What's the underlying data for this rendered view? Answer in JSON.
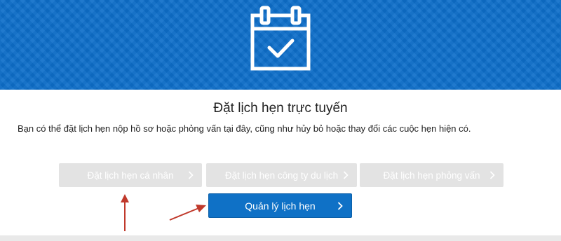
{
  "banner": {
    "color": "#0d6ec9",
    "icon": "calendar-check-icon"
  },
  "page": {
    "title": "Đặt lịch hẹn trực tuyến",
    "description": "Bạn có thể đặt lịch hẹn nộp hồ sơ hoặc phỏng vấn tại đây, cũng như hủy bỏ hoặc thay đổi các cuộc hẹn hiện có."
  },
  "buttons": {
    "personal": {
      "label": "Đặt lịch hẹn cá nhân",
      "state": "disabled"
    },
    "travel_company": {
      "label": "Đặt lịch hẹn công ty du lịch",
      "state": "disabled"
    },
    "interview": {
      "label": "Đặt lịch hẹn phỏng vấn",
      "state": "disabled"
    },
    "manage": {
      "label": "Quản lý lịch hẹn",
      "state": "active"
    }
  },
  "colors": {
    "primary": "#0f71c6",
    "disabled": "#e3e3e3",
    "annotation_arrow": "#c0392b"
  },
  "annotations": {
    "arrow_icon": "red-arrow-icon"
  }
}
